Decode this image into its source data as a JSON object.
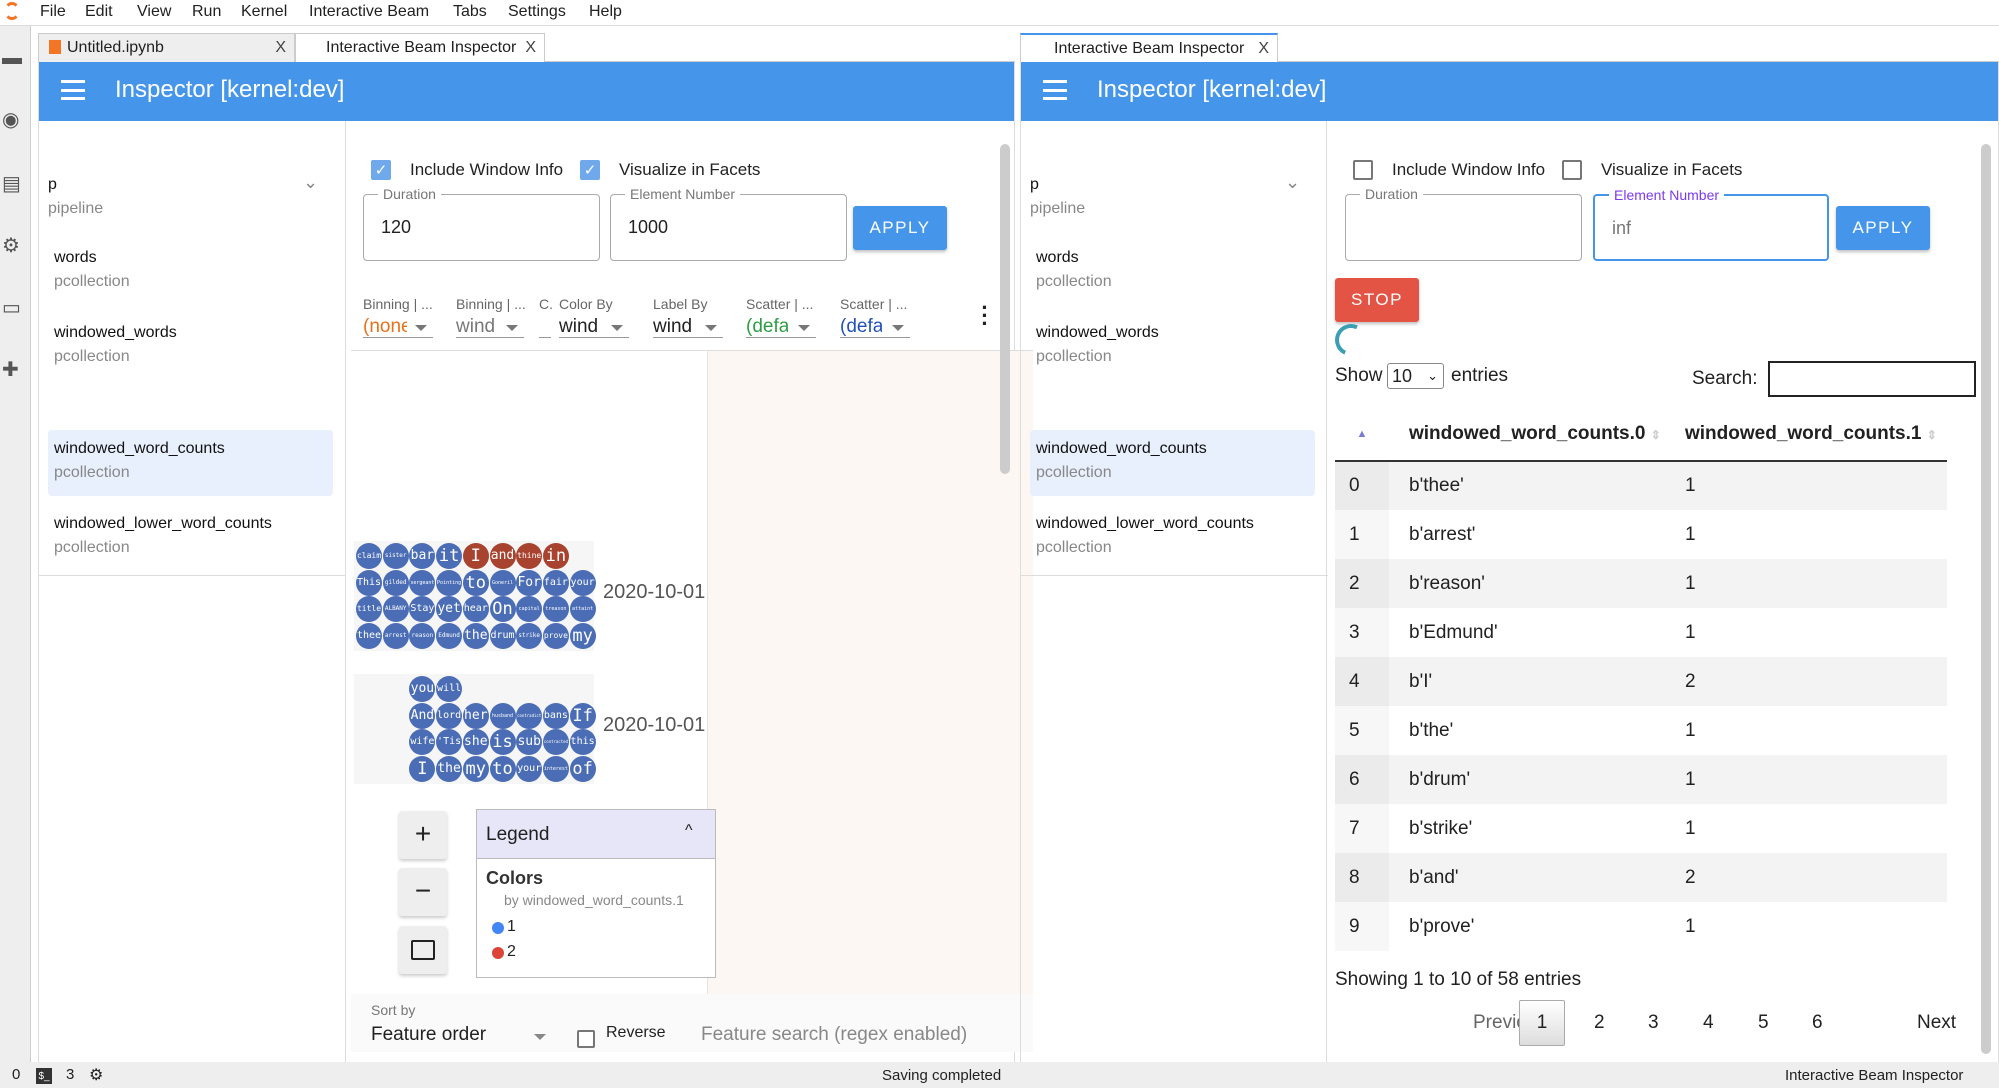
{
  "menubar": {
    "items": [
      "File",
      "Edit",
      "View",
      "Run",
      "Kernel",
      "Interactive Beam",
      "Tabs",
      "Settings",
      "Help"
    ]
  },
  "activity_icons": [
    "folder-icon",
    "running-icon",
    "commands-icon",
    "property-inspector-icon",
    "tabs-icon",
    "extension-icon"
  ],
  "left": {
    "tabs": [
      {
        "label": "Untitled.ipynb",
        "close": "X"
      },
      {
        "label": "Interactive Beam Inspector",
        "close": "X"
      }
    ],
    "header": {
      "title": "Inspector [kernel:dev]"
    },
    "sidebar": {
      "pipeline": {
        "name": "p",
        "type": "pipeline"
      },
      "items": [
        {
          "name": "words",
          "type": "pcollection"
        },
        {
          "name": "windowed_words",
          "type": "pcollection"
        },
        {
          "name": "windowed_word_counts",
          "type": "pcollection",
          "selected": true
        },
        {
          "name": "windowed_lower_word_counts",
          "type": "pcollection"
        }
      ]
    },
    "options": {
      "include_window_info": {
        "label": "Include Window Info",
        "checked": true
      },
      "visualize_in_facets": {
        "label": "Visualize in Facets",
        "checked": true
      },
      "duration": {
        "label": "Duration",
        "value": "120"
      },
      "element_number": {
        "label": "Element Number",
        "value": "1000"
      },
      "apply": "APPLY"
    },
    "facets": {
      "controls": [
        {
          "label": "Binning | ...",
          "value": "(none)",
          "color": "#e8711a"
        },
        {
          "label": "Binning | ...",
          "value": "wind",
          "color": "#777777"
        },
        {
          "label": "C.",
          "value": "",
          "color": "#777777"
        },
        {
          "label": "Color By",
          "value": "wind",
          "color": "#222222"
        },
        {
          "label": "Label By",
          "value": "wind",
          "color": "#222222"
        },
        {
          "label": "Scatter | ...",
          "value": "(default)",
          "color": "#2e9e44"
        },
        {
          "label": "Scatter | ...",
          "value": "(default)",
          "color": "#2352b6"
        }
      ],
      "colors": {
        "1": "#4a6db5",
        "2": "#a8432f"
      },
      "facets": [
        {
          "label": "2020-10-01",
          "offset": 0,
          "rows": [
            [
              [
                "claim",
                1
              ],
              [
                "sister",
                1
              ],
              [
                "bar",
                1
              ],
              [
                "it",
                1
              ],
              [
                "I",
                2
              ],
              [
                "and",
                2
              ],
              [
                "thine",
                2
              ],
              [
                "in",
                2
              ]
            ],
            [
              [
                "This",
                1
              ],
              [
                "gilded",
                1
              ],
              [
                "sergeant",
                1
              ],
              [
                "Pointing",
                1
              ],
              [
                "to",
                1
              ],
              [
                "Goneril",
                1
              ],
              [
                "For",
                1
              ],
              [
                "fair",
                1
              ],
              [
                "your",
                1
              ]
            ],
            [
              [
                "title",
                1
              ],
              [
                "ALBANY",
                1
              ],
              [
                "Stay",
                1
              ],
              [
                "yet",
                1
              ],
              [
                "hear",
                1
              ],
              [
                "On",
                1
              ],
              [
                "capital",
                1
              ],
              [
                "treason",
                1
              ],
              [
                "attaint",
                1
              ]
            ],
            [
              [
                "thee",
                1
              ],
              [
                "arrest",
                1
              ],
              [
                "reason",
                1
              ],
              [
                "Edmund",
                1
              ],
              [
                "the",
                1
              ],
              [
                "drum",
                1
              ],
              [
                "strike",
                1
              ],
              [
                "prove",
                1
              ],
              [
                "my",
                1
              ]
            ]
          ]
        },
        {
          "label": "2020-10-01",
          "offset": 2,
          "rows": [
            [
              [
                "you",
                1
              ],
              [
                "will",
                1
              ]
            ],
            [
              [
                "And",
                1
              ],
              [
                "lord",
                1
              ],
              [
                "her",
                1
              ],
              [
                "husband",
                1
              ],
              [
                "contradict",
                1
              ],
              [
                "bans",
                1
              ],
              [
                "If",
                1
              ]
            ],
            [
              [
                "wife",
                1
              ],
              [
                "'Tis",
                1
              ],
              [
                "she",
                1
              ],
              [
                "is",
                1
              ],
              [
                "sub",
                1
              ],
              [
                "contracted",
                1
              ],
              [
                "this",
                1
              ]
            ],
            [
              [
                "I",
                1
              ],
              [
                "the",
                1
              ],
              [
                "my",
                1
              ],
              [
                "to",
                1
              ],
              [
                "your",
                1
              ],
              [
                "interest",
                1
              ],
              [
                "of",
                1
              ]
            ]
          ]
        }
      ],
      "zoom": {
        "in": "+",
        "out": "−"
      },
      "legend": {
        "title": "Legend",
        "section": "Colors",
        "subtitle": "by windowed_word_counts.1",
        "entries": [
          {
            "label": "1",
            "color": "#4285f4"
          },
          {
            "label": "2",
            "color": "#db4437"
          }
        ]
      },
      "sort": {
        "label": "Sort by",
        "value": "Feature order",
        "reverse": "Reverse",
        "search_placeholder": "Feature search (regex enabled)"
      }
    }
  },
  "right": {
    "tab": {
      "label": "Interactive Beam Inspector",
      "close": "X"
    },
    "header": {
      "title": "Inspector [kernel:dev]"
    },
    "sidebar": {
      "pipeline": {
        "name": "p",
        "type": "pipeline"
      },
      "items": [
        {
          "name": "words",
          "type": "pcollection"
        },
        {
          "name": "windowed_words",
          "type": "pcollection"
        },
        {
          "name": "windowed_word_counts",
          "type": "pcollection",
          "selected": true
        },
        {
          "name": "windowed_lower_word_counts",
          "type": "pcollection"
        }
      ]
    },
    "options": {
      "include_window_info": {
        "label": "Include Window Info",
        "checked": false
      },
      "visualize_in_facets": {
        "label": "Visualize in Facets",
        "checked": false
      },
      "duration": {
        "label": "Duration",
        "value": ""
      },
      "element_number": {
        "label": "Element Number",
        "value": "inf"
      },
      "apply": "APPLY",
      "stop": "STOP"
    },
    "table": {
      "show": "Show",
      "entries_value": "10",
      "entries": "entries",
      "search_label": "Search:",
      "search_value": "",
      "columns": [
        "",
        "windowed_word_counts.0",
        "windowed_word_counts.1"
      ],
      "rows": [
        [
          "0",
          "b'thee'",
          "1"
        ],
        [
          "1",
          "b'arrest'",
          "1"
        ],
        [
          "2",
          "b'reason'",
          "1"
        ],
        [
          "3",
          "b'Edmund'",
          "1"
        ],
        [
          "4",
          "b'I'",
          "2"
        ],
        [
          "5",
          "b'the'",
          "1"
        ],
        [
          "6",
          "b'drum'",
          "1"
        ],
        [
          "7",
          "b'strike'",
          "1"
        ],
        [
          "8",
          "b'and'",
          "2"
        ],
        [
          "9",
          "b'prove'",
          "1"
        ]
      ],
      "info": "Showing 1 to 10 of 58 entries",
      "pagination": {
        "previous": "Previous",
        "pages": [
          "1",
          "2",
          "3",
          "4",
          "5",
          "6"
        ],
        "current": "1",
        "next": "Next"
      }
    }
  },
  "status": {
    "left_count": "0",
    "terminals": "3",
    "center": "Saving completed",
    "right": "Interactive Beam Inspector"
  }
}
